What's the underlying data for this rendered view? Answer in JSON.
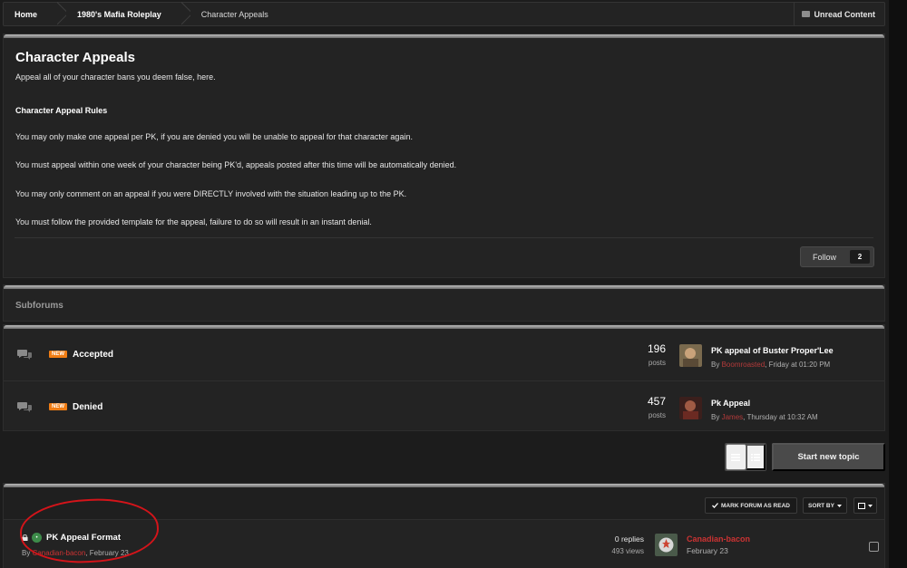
{
  "breadcrumb": {
    "home": "Home",
    "parent": "1980's Mafia Roleplay",
    "current": "Character Appeals",
    "unread_label": "Unread Content"
  },
  "header": {
    "title": "Character Appeals",
    "description": "Appeal all of your character bans you deem false, here.",
    "rules_heading": "Character Appeal Rules",
    "rules": [
      "You may only make one appeal per PK, if you are denied you will be unable to appeal for that character again.",
      "You must appeal within one week of your character being PK'd, appeals posted after this time will be automatically denied.",
      "You may only comment on an appeal if you were DIRECTLY involved with the situation leading up to the PK.",
      "You must follow the provided template for the appeal, failure to do so will result in an instant denial."
    ],
    "follow_label": "Follow",
    "follow_count": "2"
  },
  "subforums": {
    "heading": "Subforums",
    "items": [
      {
        "badge": "NEW",
        "name": "Accepted",
        "count": "196",
        "count_label": "posts",
        "last_topic": "PK appeal of Buster Proper'Lee",
        "by": "By",
        "user": "Boomroasted",
        "date": ", Friday at 01:20 PM"
      },
      {
        "badge": "NEW",
        "name": "Denied",
        "count": "457",
        "count_label": "posts",
        "last_topic": "Pk Appeal",
        "by": "By",
        "user": "James",
        "date": ", Thursday at 10:32 AM"
      }
    ]
  },
  "actions": {
    "start_topic": "Start new topic"
  },
  "topic_toolbar": {
    "mark_read": "MARK FORUM AS READ",
    "sort_by": "SORT BY"
  },
  "topics": [
    {
      "title": "PK Appeal Format",
      "by": "By",
      "author": "Canadian-bacon",
      "date": ", February 23",
      "replies": "0 replies",
      "views": "493 views",
      "last_user": "Canadian-bacon",
      "last_date": "February 23"
    }
  ],
  "colors": {
    "accent_new": "#f07d14",
    "username": "#c33333",
    "annotation": "#d4141a"
  }
}
